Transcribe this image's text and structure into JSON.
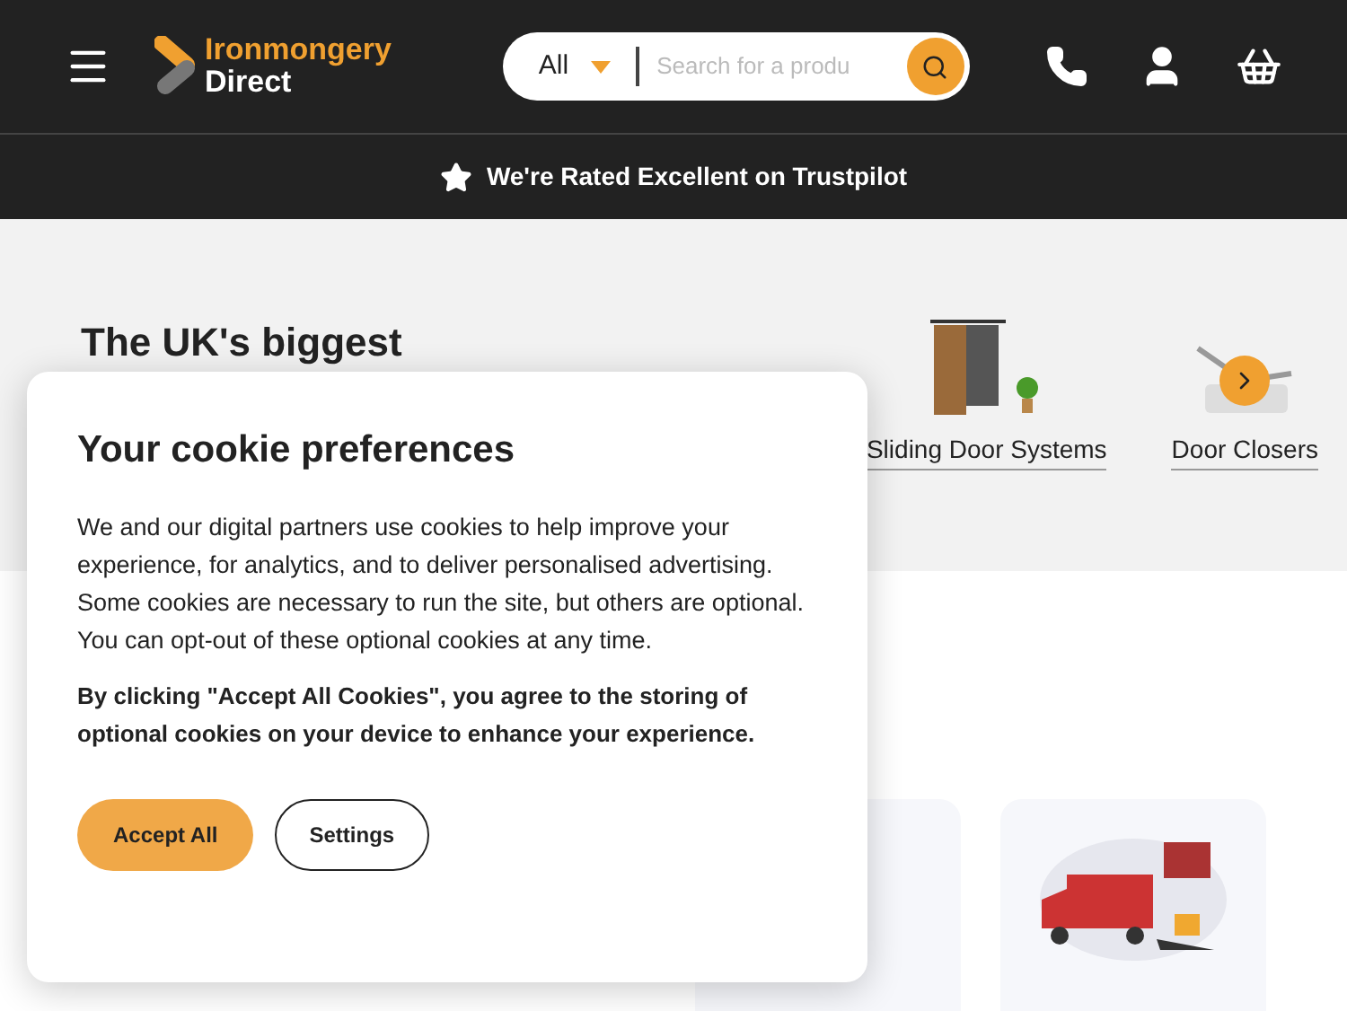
{
  "header": {
    "logo": {
      "line1": "Ironmongery",
      "line2": "Direct"
    },
    "search": {
      "category": "All",
      "placeholder": "Search for a produ"
    }
  },
  "banner": {
    "text": "We're Rated Excellent on Trustpilot"
  },
  "hero": {
    "heading": "The UK's biggest"
  },
  "categories": [
    {
      "label": "Sliding Door Systems",
      "kind": "sliding"
    },
    {
      "label": "Door Closers",
      "kind": "closer"
    }
  ],
  "reasons": [
    {
      "kind": "plain"
    },
    {
      "kind": "delivery"
    }
  ],
  "cookie_dialog": {
    "title": "Your cookie preferences",
    "body": "We and our digital partners use cookies to help improve your experience, for analytics, and to deliver personalised advertising. Some cookies are necessary to run the site, but others are optional. You can opt-out of these optional cookies at any time.",
    "notice": "By clicking \"Accept All Cookies\", you agree to the storing of optional cookies on your device to enhance your experience.",
    "buttons": [
      {
        "label": "Accept All",
        "kind": "primary"
      },
      {
        "label": "Settings",
        "kind": "secondary"
      }
    ]
  }
}
